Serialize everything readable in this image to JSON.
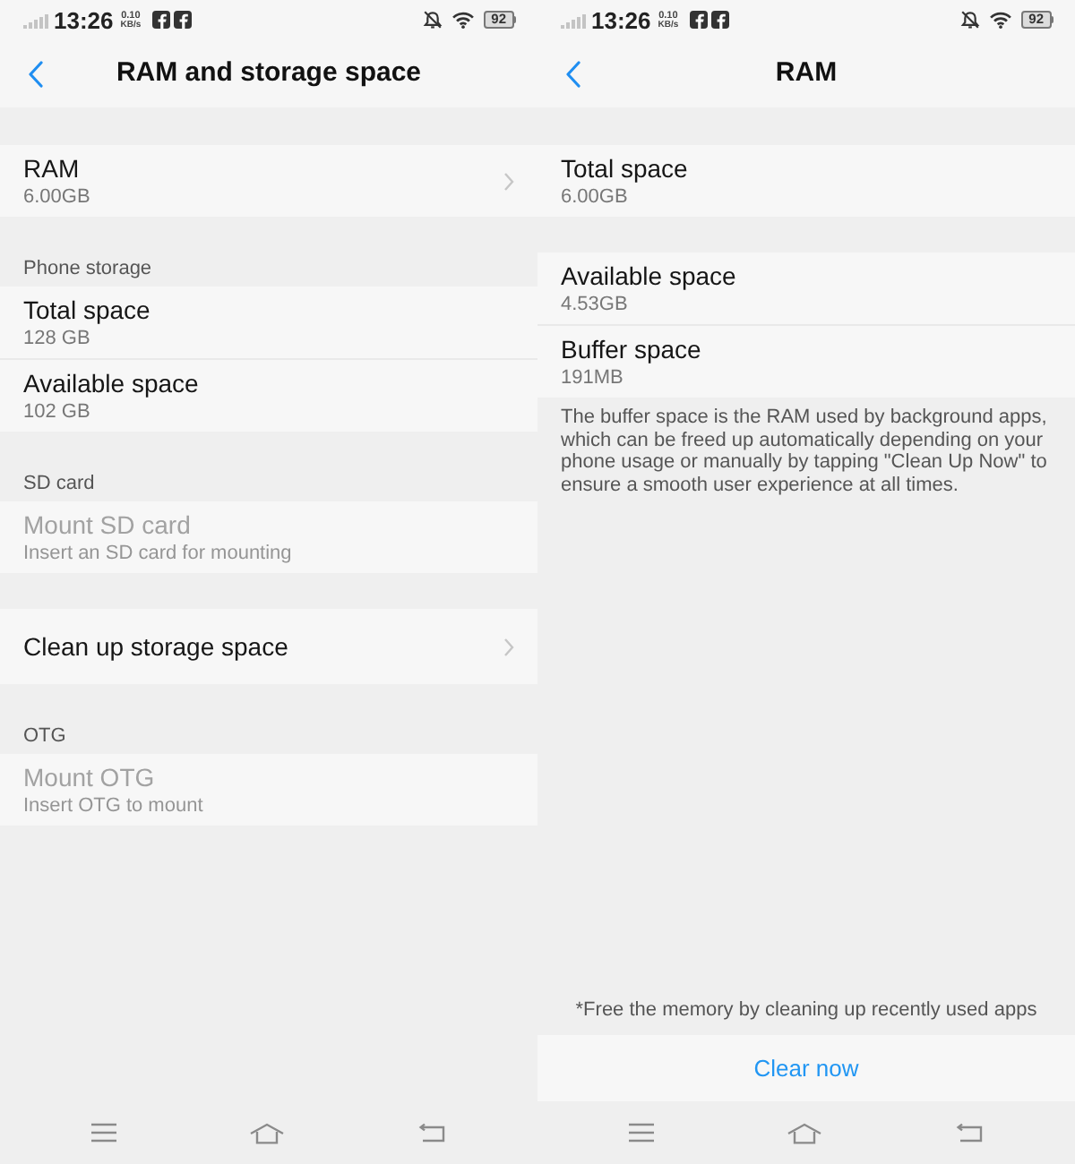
{
  "screens": [
    {
      "status_bar": {
        "time": "13:26",
        "speed_value": "0.10",
        "speed_unit": "KB/s",
        "battery": "92"
      },
      "header": {
        "title": "RAM and storage space"
      },
      "groups": [
        {
          "items": [
            {
              "title": "RAM",
              "subtitle": "6.00GB",
              "disabled": false,
              "navigable": true
            }
          ]
        },
        {
          "heading": "Phone storage",
          "items": [
            {
              "title": "Total space",
              "subtitle": "128 GB",
              "disabled": false,
              "navigable": false
            },
            {
              "title": "Available space",
              "subtitle": "102 GB",
              "disabled": false,
              "navigable": false
            }
          ]
        },
        {
          "heading": "SD card",
          "items": [
            {
              "title": "Mount SD card",
              "subtitle": "Insert an SD card for mounting",
              "disabled": true,
              "navigable": false
            }
          ]
        },
        {
          "items": [
            {
              "title": "Clean up storage space",
              "disabled": false,
              "navigable": true
            }
          ]
        },
        {
          "heading": "OTG",
          "items": [
            {
              "title": "Mount OTG",
              "subtitle": "Insert OTG to mount",
              "disabled": true,
              "navigable": false
            }
          ]
        }
      ]
    },
    {
      "status_bar": {
        "time": "13:26",
        "speed_value": "0.10",
        "speed_unit": "KB/s",
        "battery": "92"
      },
      "header": {
        "title": "RAM"
      },
      "groups": [
        {
          "items": [
            {
              "title": "Total space",
              "subtitle": "6.00GB",
              "disabled": false,
              "navigable": false
            }
          ]
        },
        {
          "items": [
            {
              "title": "Available space",
              "subtitle": "4.53GB",
              "disabled": false,
              "navigable": false
            },
            {
              "title": "Buffer space",
              "subtitle": "191MB",
              "disabled": false,
              "navigable": false
            }
          ],
          "note": "The buffer space is the RAM used by background apps, which can be freed up automatically depending on your phone usage or manually by tapping \"Clean Up Now\" to ensure a smooth user experience at all times."
        }
      ],
      "footnote": "*Free the memory by cleaning up recently used apps",
      "action_button": "Clear now"
    }
  ]
}
